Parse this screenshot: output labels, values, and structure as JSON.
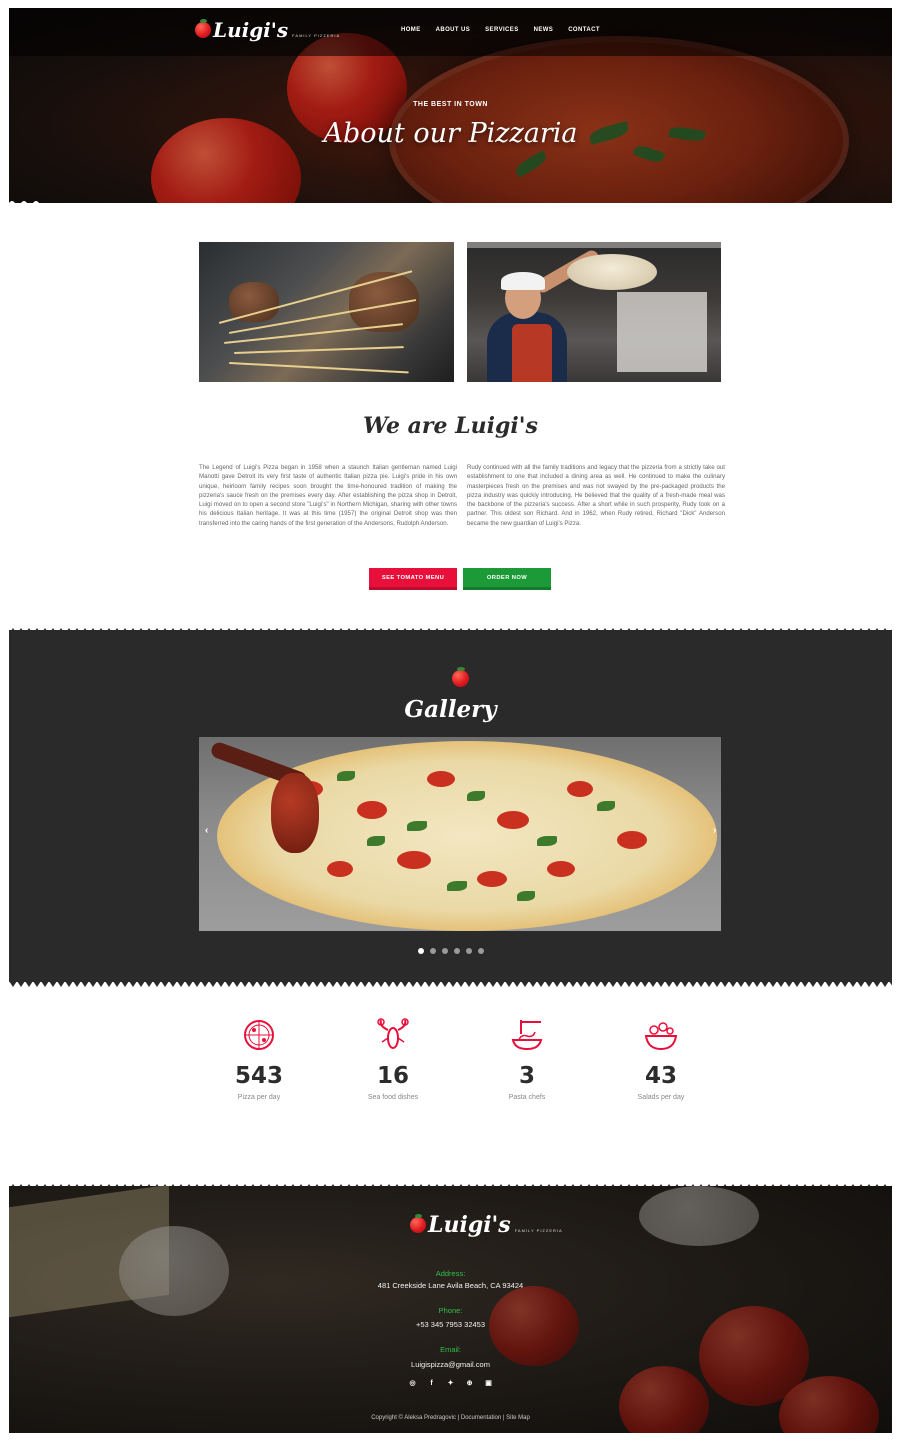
{
  "brand": {
    "name": "Luigi's",
    "tagline": "FAMILY PIZZERIA"
  },
  "nav": {
    "items": [
      "HOME",
      "ABOUT US",
      "SERVICES",
      "NEWS",
      "CONTACT"
    ]
  },
  "hero": {
    "kicker": "THE BEST IN TOWN",
    "title": "About our Pizzaria"
  },
  "about": {
    "title": "We are Luigi's",
    "col_left": "The Legend of Luigi's Pizza began in 1958 when a staunch Italian gentleman named Luigi Manotti gave Detroit its very first taste of authentic Italian pizza pie. Luigi's pride in his own unique, heirloom family recipes soon brought the time-honoured tradition of making the pizzeria's sauce fresh on the premises every day. After establishing the pizza shop in Detroit, Luigi moved on to open a second store \"Luigi's\" in Northern Michigan, sharing with other towns his delicious Italian heritage. It was at this time (1957) the original Detroit shop was then transferred into the caring hands of the first generation of the Andersons, Rudolph Anderson.",
    "col_right": "Rudy continued with all the family traditions and legacy that the pizzeria from a strictly take out establishment to one that included a dining area as well. He continued to make the culinary masterpieces fresh on the premises and was not swayed by the pre-packaged products the pizza industry was quickly introducing. He believed that the quality of a fresh-made meal was the backbone of the pizzeria's success. After a short while in such prosperity, Rudy took on a partner. This oldest son Richard. And in 1962, when Rudy retired, Richard \"Dick\" Anderson became the new guardian of Luigi's Pizza.",
    "btn_menu": "SEE TOMATO MENU",
    "btn_order": "ORDER NOW"
  },
  "gallery": {
    "title": "Gallery",
    "prev": "‹",
    "next": "›",
    "slide_count": 6,
    "active_index": 0
  },
  "stats": [
    {
      "value": "543",
      "label": "Pizza per day",
      "icon": "pizza-icon"
    },
    {
      "value": "16",
      "label": "Sea food dishes",
      "icon": "lobster-icon"
    },
    {
      "value": "3",
      "label": "Pasta chefs",
      "icon": "pasta-icon"
    },
    {
      "value": "43",
      "label": "Salads per day",
      "icon": "salad-icon"
    }
  ],
  "footer": {
    "address_label": "Address:",
    "address": "481 Creekside Lane Avila Beach, CA 93424",
    "phone_label": "Phone:",
    "phone": "+53 345 7953 32453",
    "email_label": "Email:",
    "email": "Luigispizza@gmail.com",
    "social": [
      "instagram-icon",
      "facebook-icon",
      "twitter-icon",
      "dribbble-icon",
      "youtube-icon"
    ],
    "copyright": "Copyright © Aleksa Predragovic | Documentation | Site Map"
  },
  "colors": {
    "accent_red": "#e8103a",
    "accent_green": "#1b9a37",
    "dark_section": "#2a2a2a",
    "footer_label": "#2ec04a"
  }
}
